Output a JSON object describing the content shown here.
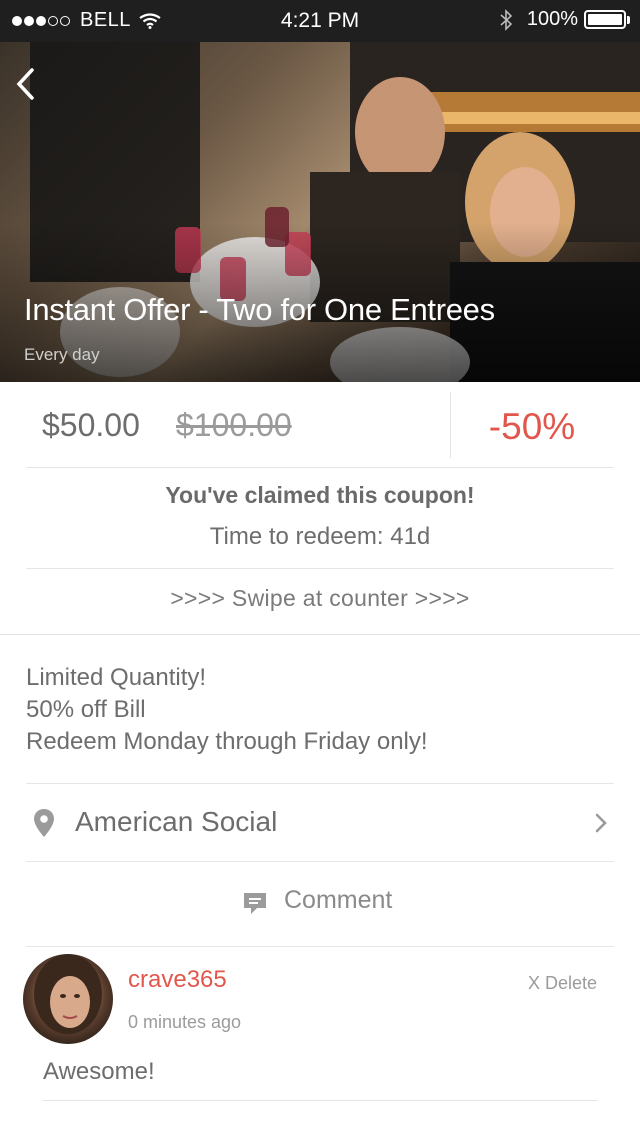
{
  "status_bar": {
    "carrier": "BELL",
    "time": "4:21 PM",
    "battery": "100%",
    "battery_level": 1.0,
    "signal_bars_filled": 3,
    "signal_bars_total": 5
  },
  "offer": {
    "title": "Instant Offer - Two for One Entrees",
    "schedule": "Every day",
    "price": "$50.00",
    "original_price": "$100.00",
    "discount": "-50%"
  },
  "claim": {
    "title": "You've claimed this coupon!",
    "time_to_redeem": "Time to redeem: 41d",
    "swipe_label": ">>>> Swipe at counter >>>>"
  },
  "description": [
    "Limited Quantity!",
    "50% off Bill",
    "Redeem Monday through Friday only!"
  ],
  "location": {
    "name": "American Social"
  },
  "comment_button": {
    "label": "Comment"
  },
  "comments": [
    {
      "username": "crave365",
      "posted": "0 minutes ago",
      "delete_label": "X Delete",
      "text": "Awesome!"
    }
  ],
  "colors": {
    "accent": "#e2574c",
    "status_bar": "#1f1f1f",
    "divider": "#e6e6e6"
  },
  "icons": {
    "back": "chevron-left-icon",
    "location": "map-pin-icon",
    "forward": "chevron-right-icon",
    "comment": "speech-bubble-icon"
  }
}
